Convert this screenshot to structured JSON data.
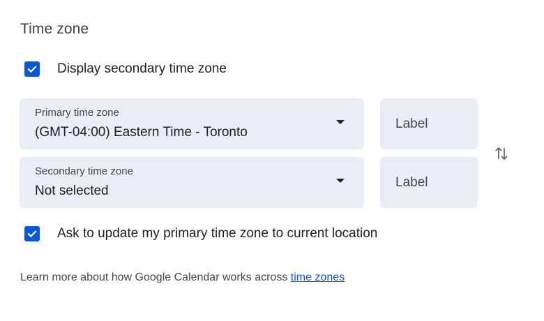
{
  "section": {
    "title": "Time zone"
  },
  "display_secondary": {
    "label": "Display secondary time zone",
    "checked": true
  },
  "primary": {
    "caption": "Primary time zone",
    "value": "(GMT-04:00) Eastern Time - Toronto",
    "label_placeholder": "Label"
  },
  "secondary": {
    "caption": "Secondary time zone",
    "value": "Not selected",
    "label_placeholder": "Label"
  },
  "ask_update": {
    "label": "Ask to update my primary time zone to current location",
    "checked": true
  },
  "footer": {
    "text": "Learn more about how Google Calendar works across ",
    "link": "time zones"
  },
  "icons": {
    "checkbox": "check-icon",
    "dropdown": "caret-down-icon",
    "swap": "swap-vertical-icon"
  },
  "colors": {
    "accent": "#0b57d0",
    "field_background": "#e9eef6",
    "text": "#1f1f1f",
    "secondary_text": "#444746"
  }
}
